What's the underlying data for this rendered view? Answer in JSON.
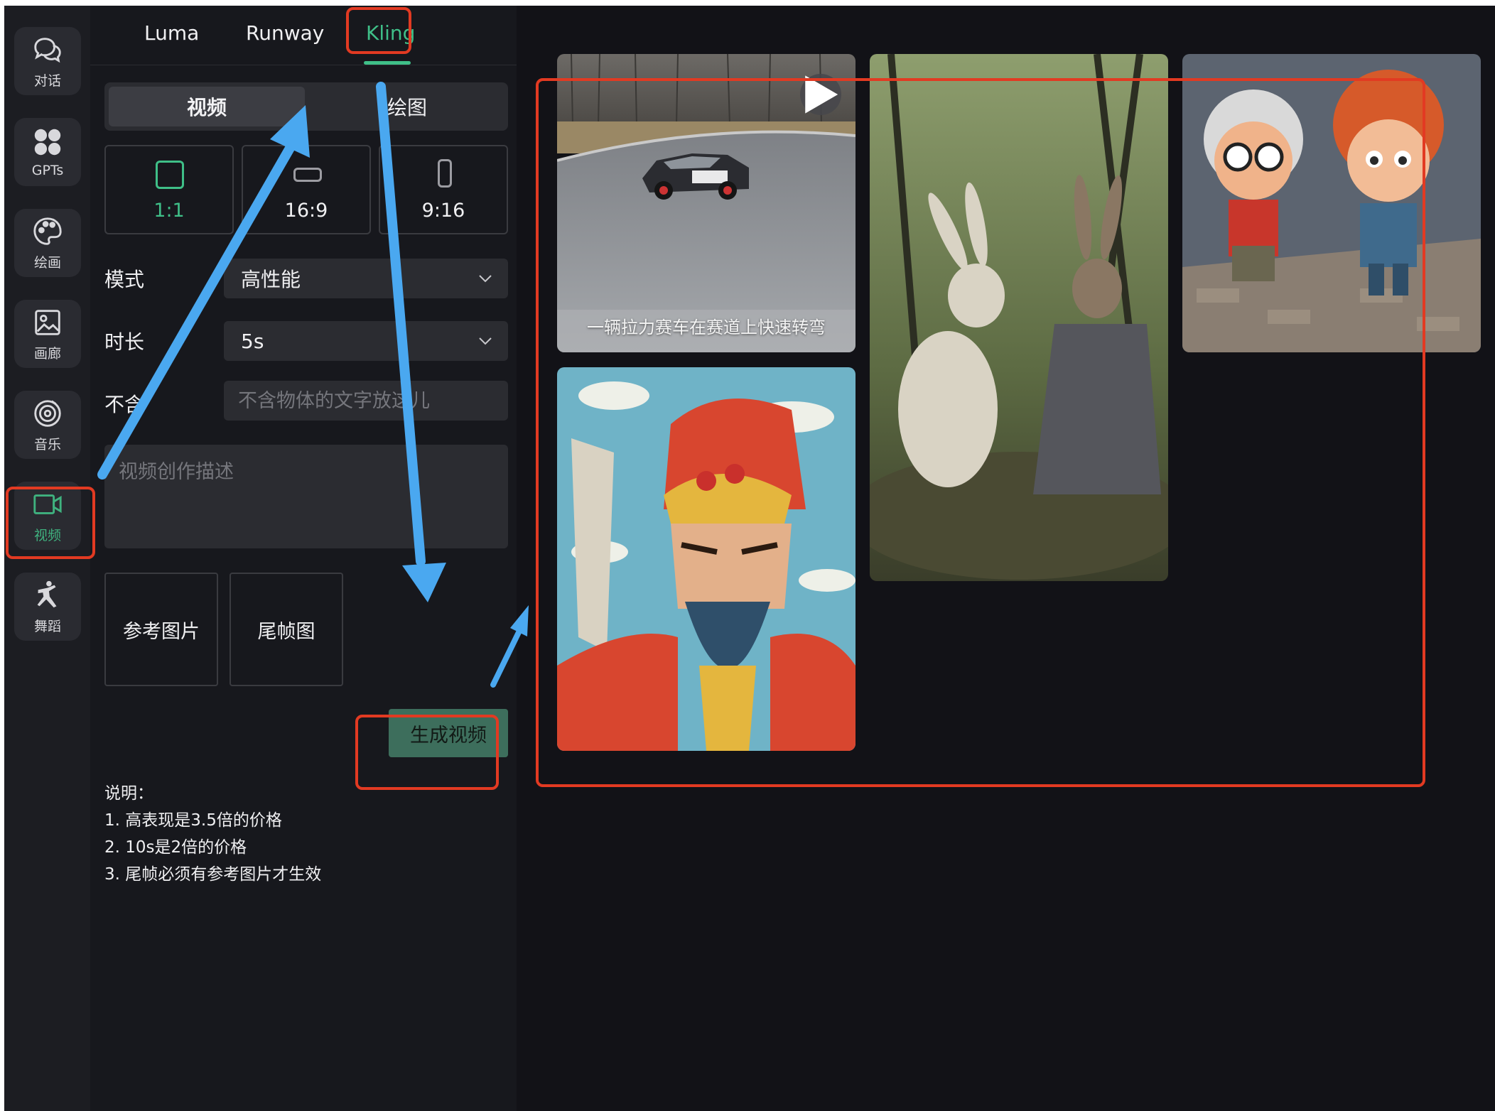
{
  "sidebar": {
    "items": [
      {
        "label": "对话",
        "icon": "chat-icon"
      },
      {
        "label": "GPTs",
        "icon": "apps-grid-icon"
      },
      {
        "label": "绘画",
        "icon": "palette-icon"
      },
      {
        "label": "画廊",
        "icon": "image-icon"
      },
      {
        "label": "音乐",
        "icon": "music-disc-icon"
      },
      {
        "label": "视频",
        "icon": "video-camera-icon",
        "active": true
      },
      {
        "label": "舞蹈",
        "icon": "dance-icon"
      }
    ]
  },
  "tabs": [
    {
      "label": "Luma"
    },
    {
      "label": "Runway"
    },
    {
      "label": "Kling",
      "active": true
    }
  ],
  "mode_switch": {
    "video": "视频",
    "draw": "绘图",
    "selected": "视频"
  },
  "aspect_ratios": [
    {
      "label": "1:1",
      "active": true
    },
    {
      "label": "16:9"
    },
    {
      "label": "9:16"
    }
  ],
  "form": {
    "mode_label": "模式",
    "mode_value": "高性能",
    "duration_label": "时长",
    "duration_value": "5s",
    "negative_label": "不含",
    "negative_placeholder": "不含物体的文字放这儿",
    "prompt_placeholder": "视频创作描述",
    "ref_image": "参考图片",
    "tail_frame": "尾帧图",
    "generate": "生成视频"
  },
  "notes": {
    "title": "说明：",
    "lines": [
      "1. 高表现是3.5倍的价格",
      "2. 10s是2倍的价格",
      "3. 尾帧必须有参考图片才生效"
    ]
  },
  "gallery": {
    "items": [
      {
        "caption": "一辆拉力赛车在赛道上快速转弯",
        "icon": "play-icon"
      }
    ]
  },
  "colors": {
    "accent": "#3fbf88",
    "annotation_red": "#e23a22",
    "annotation_blue": "#4aa8f0",
    "background": "#121217",
    "panel": "#17181d"
  }
}
